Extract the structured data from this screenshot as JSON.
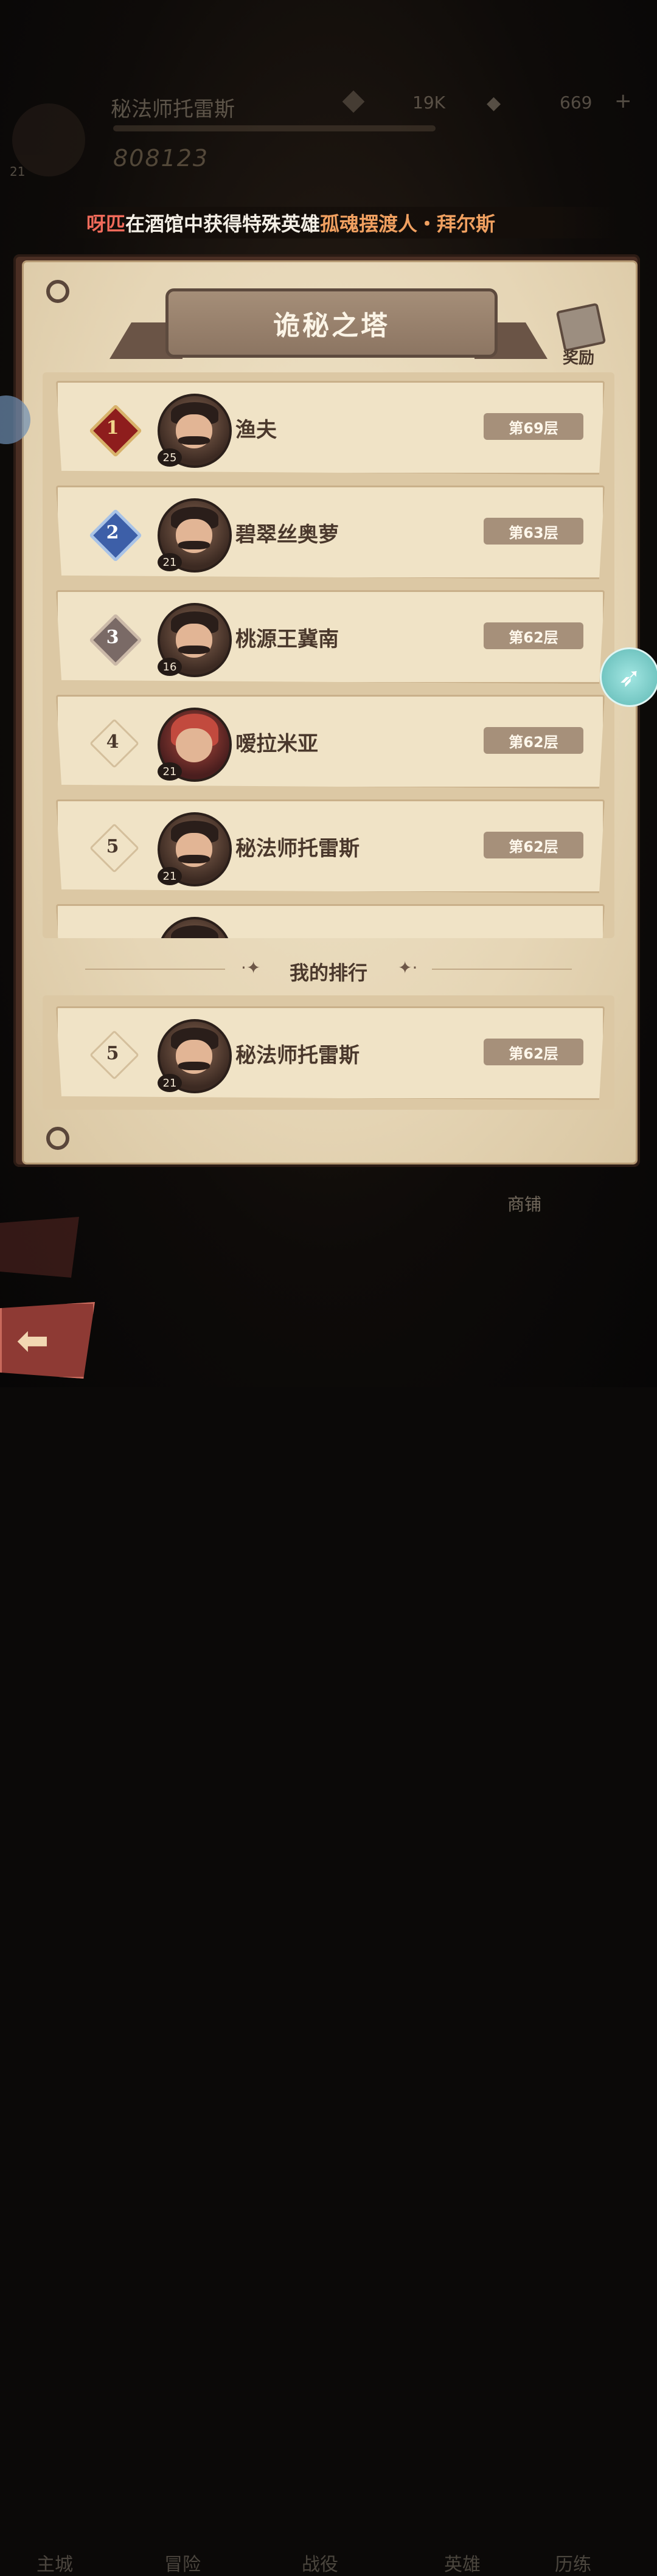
{
  "background": {
    "player_name": "秘法师托雷斯",
    "level": "21",
    "power": "808123",
    "gold": "19K",
    "diamonds": "669"
  },
  "marquee": {
    "player": "呀匹",
    "message": "在酒馆中获得特殊英雄",
    "hero": "孤魂摆渡人・拜尔斯"
  },
  "panel": {
    "title": "诡秘之塔",
    "reward_label": "奖励"
  },
  "ranking": [
    {
      "rank": "1",
      "name": "渔夫",
      "level": "25",
      "floor": "第69层",
      "avatar": "male"
    },
    {
      "rank": "2",
      "name": "碧翠丝奥萝",
      "level": "21",
      "floor": "第63层",
      "avatar": "male"
    },
    {
      "rank": "3",
      "name": "桃源王冀南",
      "level": "16",
      "floor": "第62层",
      "avatar": "male"
    },
    {
      "rank": "4",
      "name": "嗳拉米亚",
      "level": "21",
      "floor": "第62层",
      "avatar": "female"
    },
    {
      "rank": "5",
      "name": "秘法师托雷斯",
      "level": "21",
      "floor": "第62层",
      "avatar": "male"
    }
  ],
  "my_rank_title": "我的排行",
  "my_rank": {
    "rank": "5",
    "name": "秘法师托雷斯",
    "level": "21",
    "floor": "第62层"
  },
  "bottom_nav": {
    "shop": "商铺",
    "items": [
      "主城",
      "冒险",
      "战役",
      "英雄",
      "历练"
    ]
  },
  "colors": {
    "marquee_player": "#f06a5a",
    "marquee_hero": "#f0a060",
    "rank1": "#8e1d1d",
    "rank2": "#3d5fa8",
    "rank3": "#7a6a66"
  }
}
